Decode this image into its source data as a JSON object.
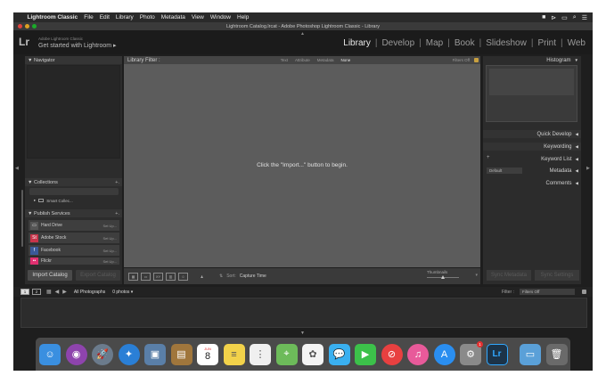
{
  "menubar": {
    "apple": "",
    "items": [
      "Lightroom Classic",
      "File",
      "Edit",
      "Library",
      "Photo",
      "Metadata",
      "View",
      "Window",
      "Help"
    ]
  },
  "window": {
    "title": "Lightroom Catalog.lrcat - Adobe Photoshop Lightroom Classic - Library"
  },
  "identity": {
    "logo": "Lr",
    "brand": "Adobe Lightroom Classic",
    "tagline": "Get started with Lightroom ▸"
  },
  "modules": [
    "Library",
    "Develop",
    "Map",
    "Book",
    "Slideshow",
    "Print",
    "Web"
  ],
  "left_panel": {
    "navigator": "Navigator",
    "collections": "Collections",
    "smart_collections": "Smart Collec...",
    "publish_services": "Publish Services",
    "publish_items": [
      {
        "label": "Hard Drive",
        "setup": "Set Up...",
        "color": "#555555",
        "glyph": "▭"
      },
      {
        "label": "Adobe Stock",
        "setup": "Set Up...",
        "color": "#c8344a",
        "glyph": "St"
      },
      {
        "label": "Facebook",
        "setup": "Set Up...",
        "color": "#3b5998",
        "glyph": "f"
      },
      {
        "label": "Flickr",
        "setup": "Set Up...",
        "color": "#e03070",
        "glyph": "••"
      }
    ],
    "import_button": "Import Catalog",
    "export_button": "Export Catalog"
  },
  "library_filter": {
    "label": "Library Filter :",
    "tabs": [
      "Text",
      "Attribute",
      "Metadata",
      "None"
    ],
    "active_tab": "None",
    "filters_off": "Filters Off"
  },
  "grid": {
    "empty_message": "Click the \"Import...\" button to begin."
  },
  "toolbar": {
    "sort_label": "Sort:",
    "sort_value": "Capture Time",
    "thumbnails_label": "Thumbnails",
    "thumbnail_size": 0.5
  },
  "right_panel": {
    "histogram": "Histogram",
    "quick_develop": "Quick Develop",
    "keywording": "Keywording",
    "keyword_list": "Keyword List",
    "metadata": "Metadata",
    "metadata_preset": "Default",
    "comments": "Comments",
    "sync_metadata": "Sync Metadata",
    "sync_settings": "Sync Settings"
  },
  "filmstrip": {
    "view1": "1",
    "view2": "2",
    "source": "All Photographs",
    "count": "0 photos ▾",
    "filter_label": "Filter :",
    "filter_value": "Filters Off"
  },
  "dock": [
    {
      "name": "finder-icon",
      "color": "#3a8fe0",
      "glyph": "☺"
    },
    {
      "name": "siri-icon",
      "color": "#8e44ad",
      "glyph": "◉",
      "round": true
    },
    {
      "name": "launchpad-icon",
      "color": "#6b7b8c",
      "glyph": "🚀",
      "round": true
    },
    {
      "name": "safari-icon",
      "color": "#2a7fd6",
      "glyph": "✦",
      "round": true
    },
    {
      "name": "preview-icon",
      "color": "#5a7fa8",
      "glyph": "▣"
    },
    {
      "name": "contacts-icon",
      "color": "#a0763c",
      "glyph": "▤"
    },
    {
      "name": "calendar-icon",
      "color": "#ffffff",
      "glyph": "8",
      "month": "JUN"
    },
    {
      "name": "notes-icon",
      "color": "#f2d24a",
      "glyph": "≡"
    },
    {
      "name": "reminders-icon",
      "color": "#f0f0f0",
      "glyph": "⋮"
    },
    {
      "name": "maps-icon",
      "color": "#6dbb5a",
      "glyph": "⌖"
    },
    {
      "name": "photos-icon",
      "color": "#f3f3f3",
      "glyph": "✿"
    },
    {
      "name": "messages-icon",
      "color": "#3ab0f0",
      "glyph": "💬"
    },
    {
      "name": "facetime-icon",
      "color": "#3cc14a",
      "glyph": "▶"
    },
    {
      "name": "news-icon",
      "color": "#e84040",
      "glyph": "⊘",
      "round": true
    },
    {
      "name": "itunes-icon",
      "color": "#e85a9a",
      "glyph": "♫",
      "round": true
    },
    {
      "name": "app-store-icon",
      "color": "#2a8ef0",
      "glyph": "A",
      "round": true
    },
    {
      "name": "system-preferences-icon",
      "color": "#8a8a8a",
      "glyph": "⚙",
      "badge": "1"
    },
    {
      "name": "lightroom-icon",
      "color": "#1c3348",
      "glyph": "Lr"
    },
    {
      "name": "downloads-folder-icon",
      "color": "#5aa0d8",
      "glyph": "▭"
    },
    {
      "name": "trash-icon",
      "color": "#6a6a6a",
      "glyph": "🗑"
    }
  ]
}
